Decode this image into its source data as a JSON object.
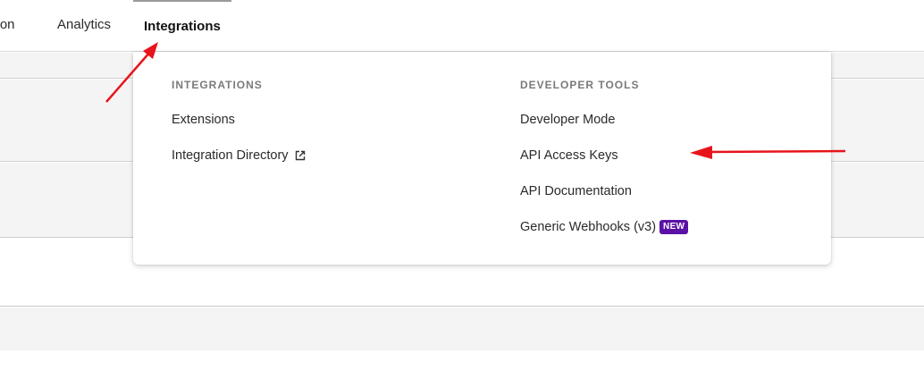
{
  "nav": {
    "items": [
      {
        "label": "ation"
      },
      {
        "label": "Analytics"
      },
      {
        "label": "Integrations",
        "active": true
      }
    ]
  },
  "dropdown": {
    "integrations": {
      "heading": "INTEGRATIONS",
      "items": [
        {
          "label": "Extensions"
        },
        {
          "label": "Integration Directory",
          "icon": "external-link-icon"
        }
      ]
    },
    "developer_tools": {
      "heading": "DEVELOPER TOOLS",
      "items": [
        {
          "label": "Developer Mode"
        },
        {
          "label": "API Access Keys"
        },
        {
          "label": "API Documentation"
        },
        {
          "label": "Generic Webhooks (v3)",
          "badge": "NEW"
        }
      ]
    }
  },
  "colors": {
    "badge_bg": "#5b12a6",
    "annotation_arrow": "#e8141b"
  }
}
